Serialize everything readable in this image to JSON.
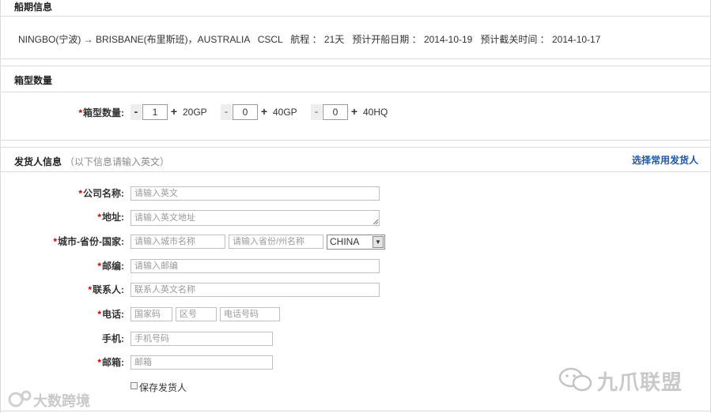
{
  "schedule": {
    "title": "船期信息",
    "route_line": "NINGBO(宁波) → BRISBANE(布里斯班)，AUSTRALIA   CSCL   航程 ： 21天   预计开船日期 ： 2014-10-19   预计截关时间 ： 2014-10-17"
  },
  "container": {
    "title": "箱型数量",
    "label": "箱型数量:",
    "types": [
      {
        "value": "1",
        "unit": "20GP"
      },
      {
        "value": "0",
        "unit": "40GP"
      },
      {
        "value": "0",
        "unit": "40HQ"
      }
    ],
    "minus": "-",
    "plus": "+"
  },
  "shipper": {
    "title": "发货人信息",
    "subtitle": "（以下信息请输入英文）",
    "select_link": "选择常用发货人",
    "company": {
      "label": "公司名称:",
      "placeholder": "请输入英文"
    },
    "address": {
      "label": "地址:",
      "placeholder": "请输入英文地址"
    },
    "city_region": {
      "label": "城市-省份-国家:",
      "city_placeholder": "请输入城市名称",
      "province_placeholder": "请输入省份/州名称",
      "country": "CHINA"
    },
    "postcode": {
      "label": "邮编:",
      "placeholder": "请输入邮编"
    },
    "contact": {
      "label": "联系人:",
      "placeholder": "联系人英文名称"
    },
    "phone": {
      "label": "电话:",
      "country_placeholder": "国家码",
      "area_placeholder": "区号",
      "number_placeholder": "电话号码"
    },
    "mobile": {
      "label": "手机:",
      "placeholder": "手机号码"
    },
    "email": {
      "label": "邮箱:",
      "placeholder": "邮箱"
    },
    "save_label": "保存发货人",
    "required_mark": "*"
  },
  "watermarks": {
    "left": "大数跨境",
    "right": "九爪联盟"
  }
}
